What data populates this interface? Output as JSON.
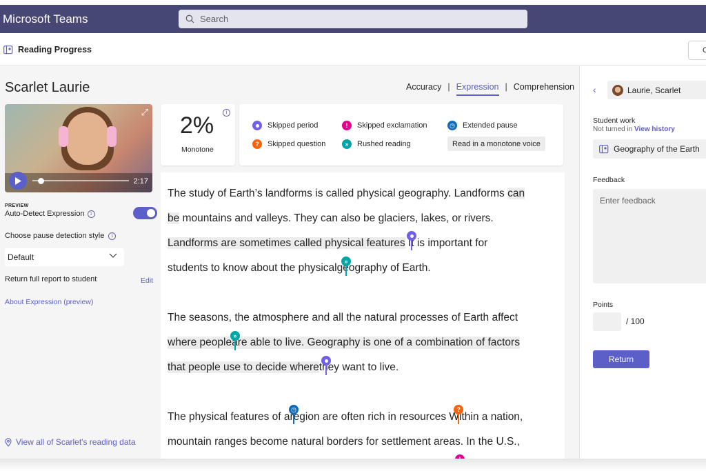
{
  "app": {
    "title": "Microsoft Teams"
  },
  "search": {
    "placeholder": "Search"
  },
  "subheader": {
    "app_name": "Reading Progress",
    "right_button_label": "C"
  },
  "student": {
    "name": "Scarlet Laurie"
  },
  "video": {
    "duration": "2:17",
    "progress": 0.06
  },
  "settings": {
    "preview_tag": "PREVIEW",
    "auto_detect_label": "Auto-Detect Expression",
    "auto_detect_on": true,
    "pause_style_label": "Choose pause detection style",
    "pause_style_value": "Default",
    "return_label": "Return full report to student",
    "edit_label": "Edit",
    "about_link": "About Expression (preview)",
    "view_all_link": "View all of Scarlet's reading data"
  },
  "tabs": [
    {
      "label": "Accuracy",
      "active": false
    },
    {
      "label": "Expression",
      "active": true
    },
    {
      "label": "Comprehension",
      "active": false
    }
  ],
  "score": {
    "value": "2%",
    "caption": "Monotone"
  },
  "legend": {
    "skipped_period": "Skipped period",
    "skipped_exclamation": "Skipped exclamation",
    "extended_pause": "Extended pause",
    "skipped_question": "Skipped question",
    "rushed_reading": "Rushed reading",
    "monotone": "Read in a monotone voice"
  },
  "colors": {
    "accent": "#5b5fc7",
    "teams_purple": "#464775",
    "skipped_period": "#7160e8",
    "skipped_exclamation": "#e3008c",
    "extended_pause": "#0f6cbd",
    "skipped_question": "#f7630c",
    "rushed_reading": "#00a5a5"
  },
  "reading": {
    "l1_a": "The study of Earth’s ",
    "l1_b": "landforms",
    "l1_c": " is called physical geography. Landforms ",
    "l1_d": "can",
    "l2_a": "be",
    "l2_b": " mountains and valleys. They can also be ",
    "l2_c": "glaciers",
    "l2_d": ", lakes, or rivers.",
    "l3_a": "Landforms are sometimes called physical features",
    "l3_b": " It is important for",
    "l4_a": "students to know about the physical",
    "l4_b": "geography of Earth.",
    "l5_a": "The seasons, the ",
    "l5_b": "atmosphere",
    "l5_c": " and all ",
    "l5_d": "the",
    "l5_e": " natural processes of Earth affect",
    "l6_a": "where people",
    "l6_b": "are able to live. Geography is one of a ",
    "l6_c": "combination",
    "l6_d": " of factors",
    "l7_a": "that people use to decide where",
    "l7_b": "they want to live.",
    "l8_a": "The ",
    "l8_b": "physical",
    "l8_c": " features of a",
    "l8_d": "region are often rich in resources",
    "l8_e": " Within a nation,",
    "l9": "mountain ranges become natural borders for settlement areas. In the U.S.,"
  },
  "right_panel": {
    "student_selector": "Laurie, Scarlet",
    "student_work_label": "Student work",
    "not_turned_in": "Not turned in",
    "view_history": "View history",
    "file_name": "Geography of the Earth",
    "feedback_label": "Feedback",
    "feedback_placeholder": "Enter feedback",
    "points_label": "Points",
    "points_value": "",
    "points_max": "/ 100",
    "return_button": "Return"
  }
}
